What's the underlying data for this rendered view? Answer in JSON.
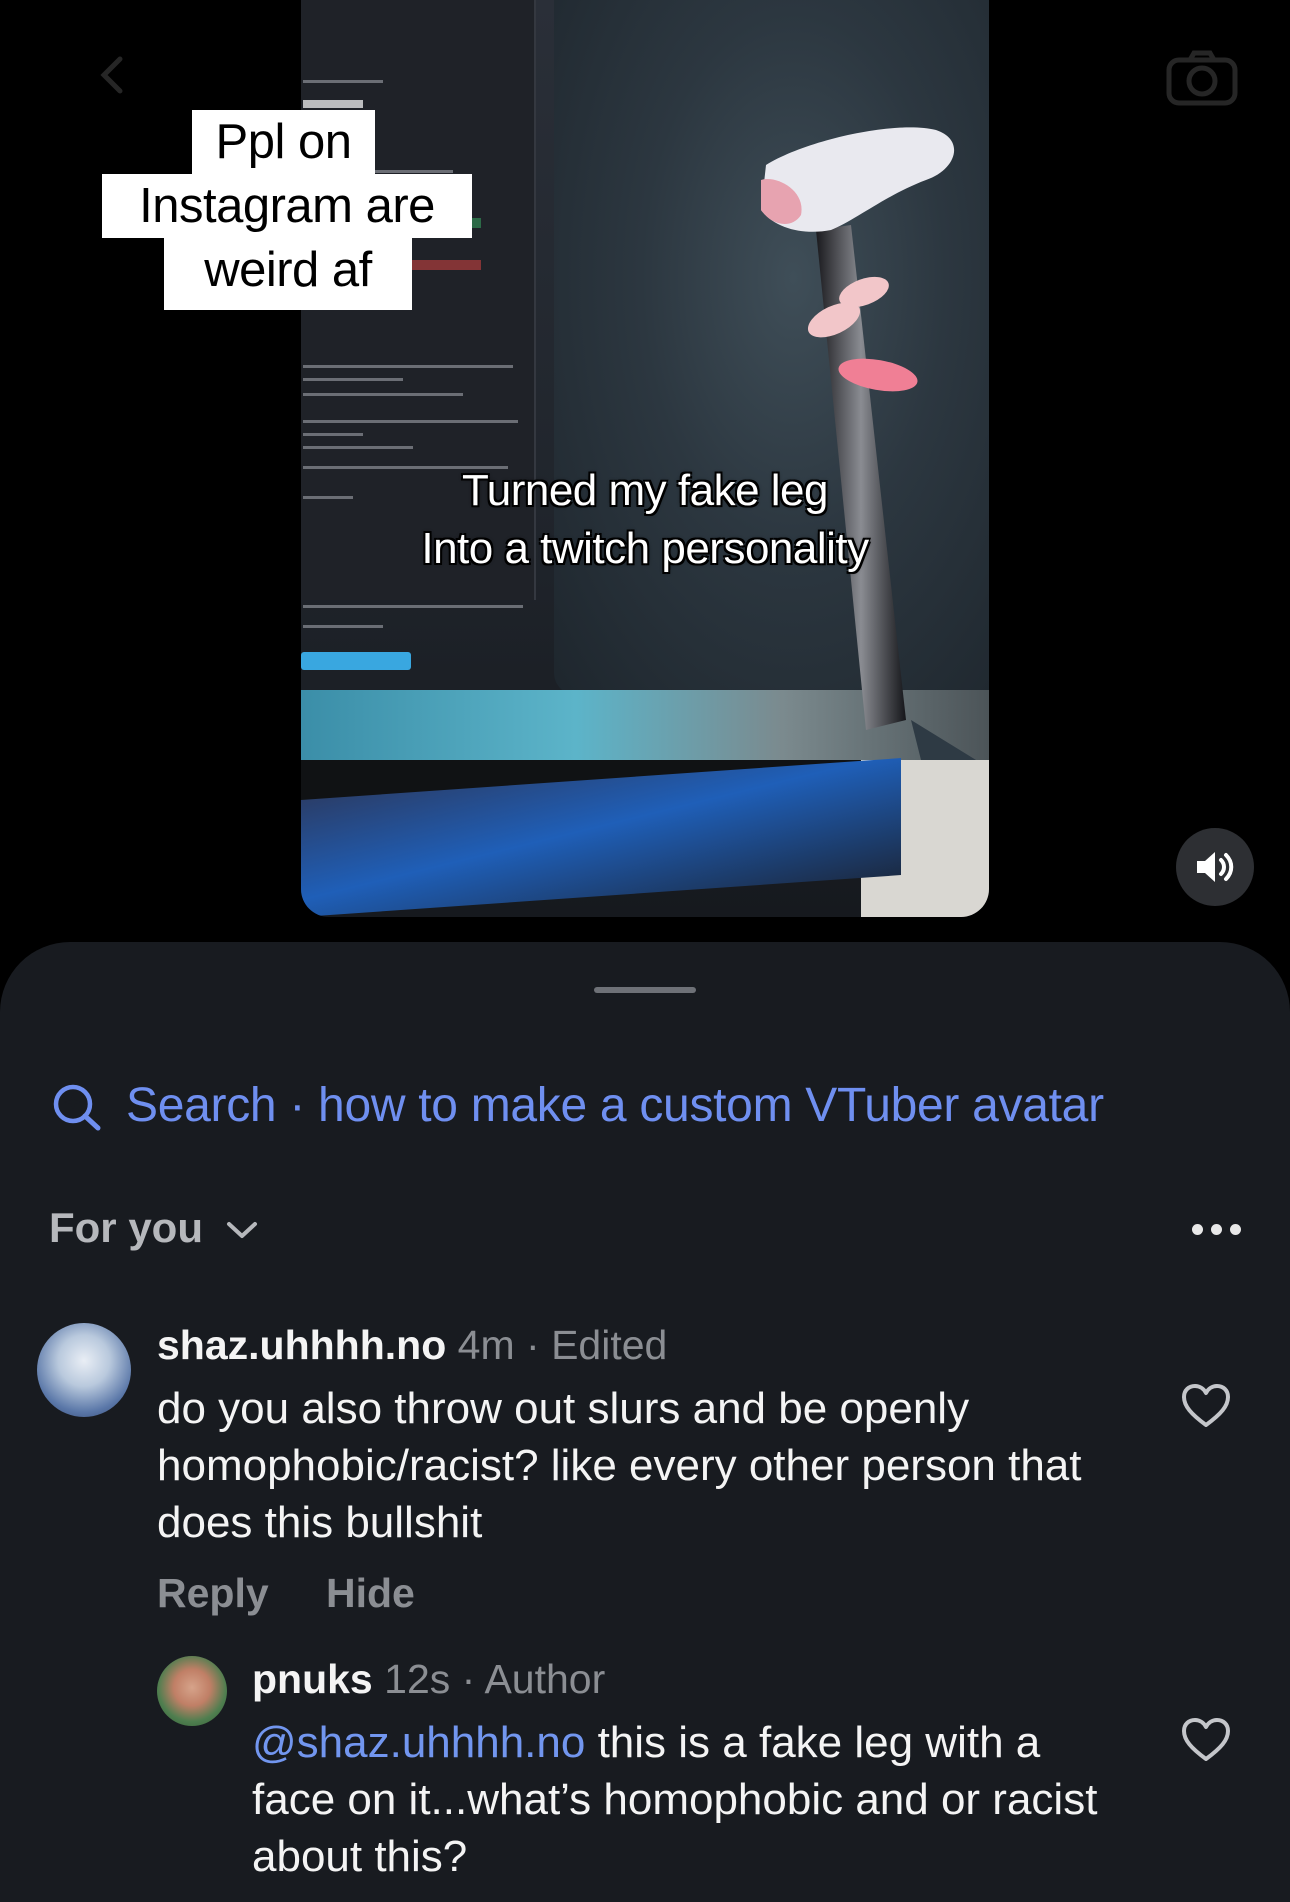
{
  "top_bar": {
    "back_icon": "chevron-left-icon",
    "camera_icon": "camera-icon"
  },
  "video": {
    "caption_lines": [
      "Ppl on",
      "Instagram are",
      "weird af"
    ],
    "overlay_lines": [
      "Turned my fake leg",
      "Into a twitch personality"
    ],
    "sound_icon": "speaker-on-icon"
  },
  "comments_sheet": {
    "search": {
      "icon": "sparkle-search-icon",
      "label": "Search · how to make a custom VTuber avatar"
    },
    "filter": {
      "label": "For you",
      "icon": "chevron-down-icon",
      "more_icon": "more-horizontal-icon"
    },
    "comments": [
      {
        "username": "shaz.uhhhh.no",
        "time": "4m",
        "tag": "· Edited",
        "text": "do you also throw out slurs and be openly homophobic/racist? like every other person that does this bullshit",
        "actions": [
          "Reply",
          "Hide"
        ],
        "like_icon": "heart-icon"
      },
      {
        "username": "pnuks",
        "time": "12s",
        "tag": "· Author",
        "mention": "@shaz.uhhhh.no",
        "text": " this is a fake leg with a face on it...what’s homophobic and or racist about this?",
        "like_icon": "heart-icon"
      }
    ]
  },
  "colors": {
    "sheet_background": "#181b20",
    "link_blue": "#6f8ff0",
    "secondary_text": "#8b8e93"
  }
}
